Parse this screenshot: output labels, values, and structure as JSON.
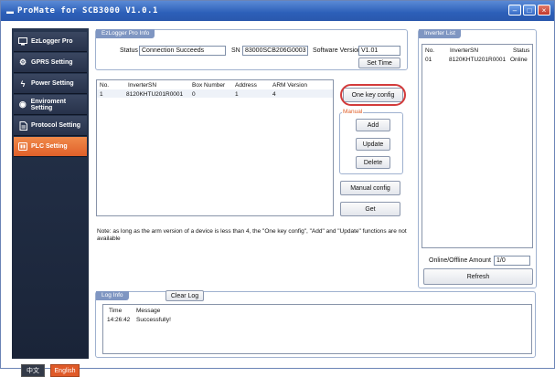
{
  "window": {
    "title": "ProMate for SCB3000 V1.0.1",
    "title_glyph": "▬"
  },
  "sidebar": {
    "items": [
      {
        "label": "EzLogger Pro",
        "icon": "monitor-icon"
      },
      {
        "label": "GPRS Setting",
        "icon": "gear-icon"
      },
      {
        "label": "Power Setting",
        "icon": "power-icon"
      },
      {
        "label": "Enviroment Setting",
        "icon": "environment-icon"
      },
      {
        "label": "Protocol Setting",
        "icon": "document-icon"
      },
      {
        "label": "PLC Setting",
        "icon": "plc-icon"
      }
    ],
    "active_index": 5,
    "lang_cn": "中文",
    "lang_en": "English"
  },
  "info": {
    "tag": "EzLogger Pro Info",
    "status_label": "Status",
    "status_value": "Connection Succeeds",
    "sn_label": "SN",
    "sn_value": "83000SCB206G0003",
    "sw_label": "Software Version",
    "sw_value": "V1.01",
    "set_time": "Set Time"
  },
  "table": {
    "headers": [
      "No.",
      "InverterSN",
      "Box Number",
      "Address",
      "ARM Version"
    ],
    "rows": [
      [
        "1",
        "8120KHTU201R0001",
        "0",
        "1",
        "4"
      ]
    ]
  },
  "buttons": {
    "one_key": "One key config",
    "manual_tag": "Manual",
    "add": "Add",
    "update": "Update",
    "delete": "Delete",
    "manual_config": "Manual config",
    "get": "Get"
  },
  "note": "Note: as long as the arm version of a device is less than 4, the \"One key config\", \"Add\" and \"Update\" functions are not available",
  "inverter_list": {
    "tag": "Inverter List",
    "headers": [
      "No.",
      "InverterSN",
      "Status"
    ],
    "rows": [
      [
        "01",
        "8120KHTU201R0001",
        "Online"
      ]
    ],
    "amount_label": "Online/Offline Amount",
    "amount_value": "1/0",
    "refresh": "Refresh"
  },
  "log": {
    "tag": "Log Info",
    "clear": "Clear Log",
    "headers": [
      "Time",
      "Message"
    ],
    "rows": [
      [
        "14:26:42",
        "Successfully!"
      ]
    ]
  },
  "colors": {
    "active_nav": "#e0602a",
    "highlight": "#d33b3b"
  }
}
